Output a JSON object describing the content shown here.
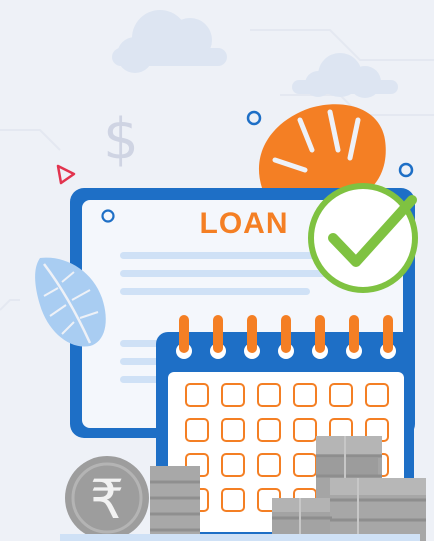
{
  "illustration": {
    "document_title": "LOAN",
    "currency_symbol": "$",
    "coin_symbol": "₹",
    "calendar": {
      "rings": 7,
      "rows": 4,
      "cols": 6
    },
    "colors": {
      "background": "#eef1f7",
      "primary_blue": "#1e6fc6",
      "light_blue": "#cfe1f6",
      "accent_orange": "#f47f24",
      "check_green": "#7fc241",
      "coin_gray": "#9d9d9d",
      "cloud": "#dde5f2"
    },
    "icons": [
      "cloud-icon",
      "dollar-icon",
      "leaf-icon",
      "triangle-icon",
      "circle-icon",
      "check-icon",
      "calendar-icon",
      "coin-icon",
      "coin-stack-icon",
      "document-icon"
    ]
  }
}
